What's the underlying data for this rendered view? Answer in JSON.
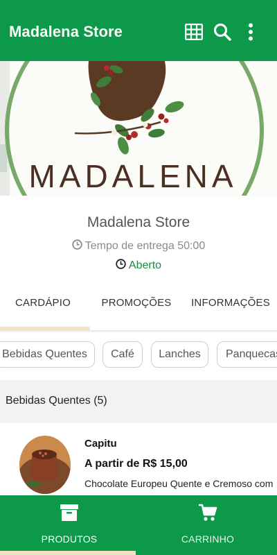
{
  "app_bar": {
    "title": "Madalena Store",
    "icons": [
      "grid-icon",
      "search-icon",
      "more-vert-icon"
    ]
  },
  "banner": {
    "logo_text": "MADALENA"
  },
  "store": {
    "name": "Madalena Store",
    "delivery_time": "Tempo de entrega 50:00",
    "status": "Aberto"
  },
  "tabs": {
    "items": [
      {
        "label": "CARDÁPIO",
        "active": true
      },
      {
        "label": "PROMOÇÕES",
        "active": false
      },
      {
        "label": "INFORMAÇÕES",
        "active": false
      }
    ]
  },
  "categories": {
    "chips": [
      {
        "label": "Bebidas Quentes"
      },
      {
        "label": "Café"
      },
      {
        "label": "Lanches"
      },
      {
        "label": "Panquecas"
      }
    ]
  },
  "section": {
    "title": "Bebidas Quentes (5)"
  },
  "products": [
    {
      "name": "Capitu",
      "price": "A partir de R$ 15,00",
      "description": "Chocolate Europeu Quente e Cremoso com"
    }
  ],
  "bottom_nav": {
    "items": [
      {
        "label": "PRODUTOS",
        "icon": "archive-box-icon",
        "active": true
      },
      {
        "label": "CARRINHO",
        "icon": "cart-icon",
        "active": false
      }
    ]
  },
  "colors": {
    "primary": "#0c9a4a",
    "status_open": "#1c8a3a",
    "active_indicator": "#f3e3c4"
  }
}
